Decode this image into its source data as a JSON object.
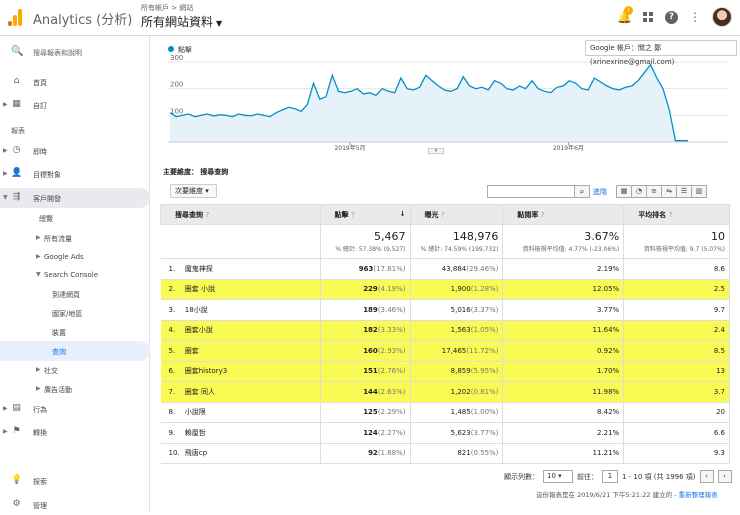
{
  "header": {
    "app_title": "Analytics (分析)",
    "breadcrumb": "所有帳戶 > 網站",
    "property": "所有網站資料",
    "bell_badge": "!",
    "account_tooltip": "Google 帳戶：閒之 鄭 (xrinexrine@gmail.com)"
  },
  "sidebar": {
    "search": "搜尋報表和說明",
    "home": "首頁",
    "custom": "自訂",
    "reports_label": "報表",
    "realtime": "即時",
    "audience": "目標對象",
    "acquisition": "客戶開發",
    "overview": "總覽",
    "all_traffic": "所有流量",
    "google_ads": "Google Ads",
    "search_console": "Search Console",
    "landing_pages": "到達網頁",
    "countries": "國家/地區",
    "devices": "裝置",
    "queries": "查詢",
    "social": "社交",
    "campaigns": "廣告活動",
    "behavior": "行為",
    "conversions": "轉換",
    "discover": "探索",
    "admin": "管理"
  },
  "chart_data": {
    "type": "area",
    "legend": "點擊",
    "y_ticks": [
      "300",
      "200",
      "100"
    ],
    "ylim": [
      0,
      300
    ],
    "x_ticks": [
      "2019年5月",
      "2019年6月"
    ],
    "values": [
      110,
      95,
      100,
      105,
      95,
      100,
      105,
      98,
      102,
      100,
      95,
      105,
      100,
      98,
      105,
      100,
      95,
      110,
      120,
      130,
      125,
      115,
      140,
      220,
      160,
      170,
      250,
      190,
      185,
      190,
      200,
      180,
      185,
      175,
      200,
      190,
      185,
      240,
      200,
      195,
      205,
      250,
      230,
      210,
      195,
      190,
      200,
      245,
      210,
      200,
      205,
      195,
      230,
      220,
      200,
      195,
      210,
      200,
      230,
      200,
      190,
      185,
      205,
      210,
      230,
      220,
      200,
      195,
      240,
      225,
      210,
      200,
      195,
      205,
      210,
      230,
      260,
      290,
      240,
      200,
      120,
      5,
      5,
      5
    ]
  },
  "dimensions": {
    "primary_label": "主要維度：",
    "primary_value": "搜尋查詢",
    "secondary": "次要維度"
  },
  "toolbar": {
    "advanced": "進階"
  },
  "table": {
    "headers": {
      "query": "搜尋查詢",
      "clicks": "點擊",
      "impressions": "曝光",
      "ctr": "點閱率",
      "position": "平均排名"
    },
    "totals": {
      "clicks": "5,467",
      "clicks_sub": "% 總計: 57.38% (9,527)",
      "impressions": "148,976",
      "impressions_sub": "% 總計: 74.59% (199,732)",
      "ctr": "3.67%",
      "ctr_sub": "資料檢視平均值: 4.77% (-23.06%)",
      "position": "10",
      "position_sub": "資料檢視平均值: 9.7 (5.07%)"
    },
    "rows": [
      {
        "n": "1.",
        "q": "魔鬼神探",
        "c": "963",
        "cp": "(17.61%)",
        "i": "43,884",
        "ip": "(29.46%)",
        "ctr": "2.19%",
        "pos": "8.6",
        "hl": false
      },
      {
        "n": "2.",
        "q": "圈套 小說",
        "c": "229",
        "cp": "(4.19%)",
        "i": "1,900",
        "ip": "(1.28%)",
        "ctr": "12.05%",
        "pos": "2.5",
        "hl": true
      },
      {
        "n": "3.",
        "q": "18小說",
        "c": "189",
        "cp": "(3.46%)",
        "i": "5,016",
        "ip": "(3.37%)",
        "ctr": "3.77%",
        "pos": "9.7",
        "hl": false
      },
      {
        "n": "4.",
        "q": "圈套小說",
        "c": "182",
        "cp": "(3.33%)",
        "i": "1,563",
        "ip": "(1.05%)",
        "ctr": "11.64%",
        "pos": "2.4",
        "hl": true
      },
      {
        "n": "5.",
        "q": "圈套",
        "c": "160",
        "cp": "(2.93%)",
        "i": "17,465",
        "ip": "(11.72%)",
        "ctr": "0.92%",
        "pos": "8.5",
        "hl": true
      },
      {
        "n": "6.",
        "q": "圈套history3",
        "c": "151",
        "cp": "(2.76%)",
        "i": "8,859",
        "ip": "(5.95%)",
        "ctr": "1.70%",
        "pos": "13",
        "hl": true
      },
      {
        "n": "7.",
        "q": "圈套 同人",
        "c": "144",
        "cp": "(2.63%)",
        "i": "1,202",
        "ip": "(0.81%)",
        "ctr": "11.98%",
        "pos": "3.7",
        "hl": true
      },
      {
        "n": "8.",
        "q": "小說限",
        "c": "125",
        "cp": "(2.29%)",
        "i": "1,485",
        "ip": "(1.00%)",
        "ctr": "8.42%",
        "pos": "20",
        "hl": false
      },
      {
        "n": "9.",
        "q": "賴厘哲",
        "c": "124",
        "cp": "(2.27%)",
        "i": "5,623",
        "ip": "(3.77%)",
        "ctr": "2.21%",
        "pos": "6.6",
        "hl": false
      },
      {
        "n": "10.",
        "q": "飛唐cp",
        "c": "92",
        "cp": "(1.68%)",
        "i": "821",
        "ip": "(0.55%)",
        "ctr": "11.21%",
        "pos": "9.3",
        "hl": false
      }
    ]
  },
  "pager": {
    "rows_label": "顯示列數：",
    "rows_value": "10",
    "goto_label": "前往：",
    "goto_value": "1",
    "range": "1 - 10 項 (共 1996 項)"
  },
  "report_note": {
    "text": "這份報表是在 2019/6/21 下午5:21:22 建立的 - ",
    "link": "重新整理報表"
  }
}
